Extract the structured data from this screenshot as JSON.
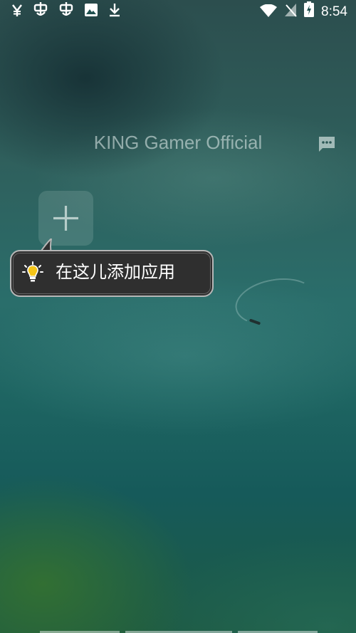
{
  "statusbar": {
    "left_icons": [
      "yuan-icon",
      "bug-icon",
      "bug-icon",
      "image-icon",
      "download-icon"
    ],
    "right_icons": [
      "wifi-icon",
      "no-signal-icon",
      "battery-charging-icon"
    ],
    "time": "8:54"
  },
  "folder": {
    "title": "KING Gamer Official",
    "chat_icon": "chat-bubble-icon"
  },
  "add_tile": {
    "icon": "plus-icon"
  },
  "tooltip": {
    "icon": "lightbulb-icon",
    "text": "在这儿添加应用"
  },
  "colors": {
    "tooltip_bg": "#2f2f2f",
    "tooltip_border": "#b7b7b7",
    "bulb_yellow": "#f5c518"
  }
}
